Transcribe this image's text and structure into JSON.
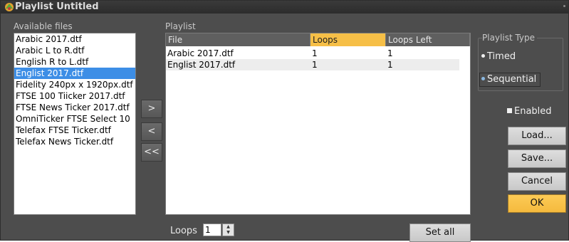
{
  "window": {
    "title": "Playlist Untitled"
  },
  "available": {
    "label": "Available files",
    "items": [
      {
        "label": "Arabic 2017.dtf",
        "selected": false
      },
      {
        "label": "Arabic L to R.dtf",
        "selected": false
      },
      {
        "label": "English R to L.dtf",
        "selected": false
      },
      {
        "label": "Englist 2017.dtf",
        "selected": true
      },
      {
        "label": "Fidelity 240px x 1920px.dtf",
        "selected": false
      },
      {
        "label": "FTSE 100 Tiicker 2017.dtf",
        "selected": false
      },
      {
        "label": "FTSE News Ticker 2017.dtf",
        "selected": false
      },
      {
        "label": "OmniTicker FTSE Select 10",
        "selected": false
      },
      {
        "label": "Telefax FTSE Ticker.dtf",
        "selected": false
      },
      {
        "label": "Telefax News Ticker.dtf",
        "selected": false
      }
    ]
  },
  "move_buttons": {
    "add": ">",
    "remove": "<",
    "remove_all": "<<"
  },
  "playlist": {
    "label": "Playlist",
    "columns": [
      "File",
      "Loops",
      "Loops Left"
    ],
    "rows": [
      {
        "file": "Arabic 2017.dtf",
        "loops": "1",
        "loops_left": "1"
      },
      {
        "file": "Englist 2017.dtf",
        "loops": "1",
        "loops_left": "1"
      }
    ]
  },
  "loops": {
    "label": "Loops",
    "value": "1"
  },
  "set_all": "Set all",
  "playlist_type": {
    "label": "Playlist Type",
    "timed": "Timed",
    "sequential": "Sequential",
    "selected": "Sequential"
  },
  "enabled": {
    "label": "Enabled",
    "checked": true
  },
  "buttons": {
    "load": "Load...",
    "save": "Save...",
    "cancel": "Cancel",
    "ok": "OK"
  },
  "colors": {
    "accent": "#f6bf47",
    "selection": "#3d8ee6",
    "panel": "#4d4d4d"
  }
}
